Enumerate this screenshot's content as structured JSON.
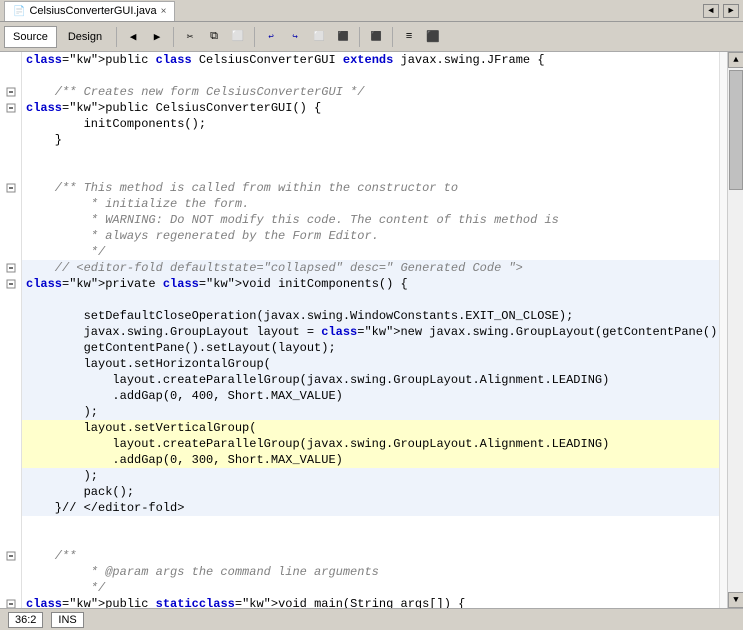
{
  "titleBar": {
    "filename": "CelsiusConverterGUI.java",
    "closeLabel": "×",
    "navLeft": "◄",
    "navRight": "►"
  },
  "toolbar": {
    "sourceTab": "Source",
    "designTab": "Design"
  },
  "statusBar": {
    "position": "36:2",
    "mode": "INS"
  },
  "code": {
    "lines": [
      {
        "indent": 0,
        "content": "public class CelsiusConverterGUI extends javax.swing.JFrame {",
        "type": "normal",
        "gutter": ""
      },
      {
        "indent": 0,
        "content": "",
        "type": "normal",
        "gutter": ""
      },
      {
        "indent": 1,
        "content": "/** Creates new form CelsiusConverterGUI */",
        "type": "comment",
        "gutter": "minus"
      },
      {
        "indent": 1,
        "content": "public CelsiusConverterGUI() {",
        "type": "normal",
        "gutter": "minus"
      },
      {
        "indent": 2,
        "content": "initComponents();",
        "type": "normal",
        "gutter": ""
      },
      {
        "indent": 1,
        "content": "}",
        "type": "normal",
        "gutter": ""
      },
      {
        "indent": 0,
        "content": "",
        "type": "normal",
        "gutter": ""
      },
      {
        "indent": 0,
        "content": "",
        "type": "normal",
        "gutter": ""
      },
      {
        "indent": 1,
        "content": "/** This method is called from within the constructor to",
        "type": "comment",
        "gutter": "minus"
      },
      {
        "indent": 2,
        "content": " * initialize the form.",
        "type": "comment",
        "gutter": ""
      },
      {
        "indent": 2,
        "content": " * WARNING: Do NOT modify this code. The content of this method is",
        "type": "comment",
        "gutter": ""
      },
      {
        "indent": 2,
        "content": " * always regenerated by the Form Editor.",
        "type": "comment",
        "gutter": ""
      },
      {
        "indent": 2,
        "content": " */",
        "type": "comment",
        "gutter": ""
      },
      {
        "indent": 1,
        "content": "// <editor-fold defaultstate=\"collapsed\" desc=\" Generated Code \">",
        "type": "fold",
        "gutter": "minus"
      },
      {
        "indent": 1,
        "content": "private void initComponents() {",
        "type": "normal",
        "gutter": "minus"
      },
      {
        "indent": 0,
        "content": "",
        "type": "normal",
        "gutter": ""
      },
      {
        "indent": 2,
        "content": "setDefaultCloseOperation(javax.swing.WindowConstants.EXIT_ON_CLOSE);",
        "type": "normal",
        "gutter": ""
      },
      {
        "indent": 2,
        "content": "javax.swing.GroupLayout layout = new javax.swing.GroupLayout(getContentPane());",
        "type": "normal",
        "gutter": ""
      },
      {
        "indent": 2,
        "content": "getContentPane().setLayout(layout);",
        "type": "normal",
        "gutter": ""
      },
      {
        "indent": 2,
        "content": "layout.setHorizontalGroup(",
        "type": "normal",
        "gutter": ""
      },
      {
        "indent": 3,
        "content": "layout.createParallelGroup(javax.swing.GroupLayout.Alignment.LEADING)",
        "type": "normal",
        "gutter": ""
      },
      {
        "indent": 3,
        "content": ".addGap(0, 400, Short.MAX_VALUE)",
        "type": "normal",
        "gutter": ""
      },
      {
        "indent": 2,
        "content": ");",
        "type": "normal",
        "gutter": ""
      },
      {
        "indent": 2,
        "content": "layout.setVerticalGroup(",
        "type": "highlighted",
        "gutter": ""
      },
      {
        "indent": 3,
        "content": "layout.createParallelGroup(javax.swing.GroupLayout.Alignment.LEADING)",
        "type": "highlighted",
        "gutter": ""
      },
      {
        "indent": 3,
        "content": ".addGap(0, 300, Short.MAX_VALUE)",
        "type": "highlighted",
        "gutter": ""
      },
      {
        "indent": 2,
        "content": ");",
        "type": "normal",
        "gutter": ""
      },
      {
        "indent": 2,
        "content": "pack();",
        "type": "normal",
        "gutter": ""
      },
      {
        "indent": 1,
        "content": "}// </editor-fold>",
        "type": "normal",
        "gutter": ""
      },
      {
        "indent": 0,
        "content": "",
        "type": "normal",
        "gutter": ""
      },
      {
        "indent": 0,
        "content": "",
        "type": "normal",
        "gutter": ""
      },
      {
        "indent": 1,
        "content": "/**",
        "type": "comment",
        "gutter": "minus"
      },
      {
        "indent": 2,
        "content": " * @param args the command line arguments",
        "type": "comment",
        "gutter": ""
      },
      {
        "indent": 2,
        "content": " */",
        "type": "comment",
        "gutter": ""
      },
      {
        "indent": 1,
        "content": "public static void main(String args[]) {",
        "type": "normal",
        "gutter": "minus"
      }
    ]
  }
}
